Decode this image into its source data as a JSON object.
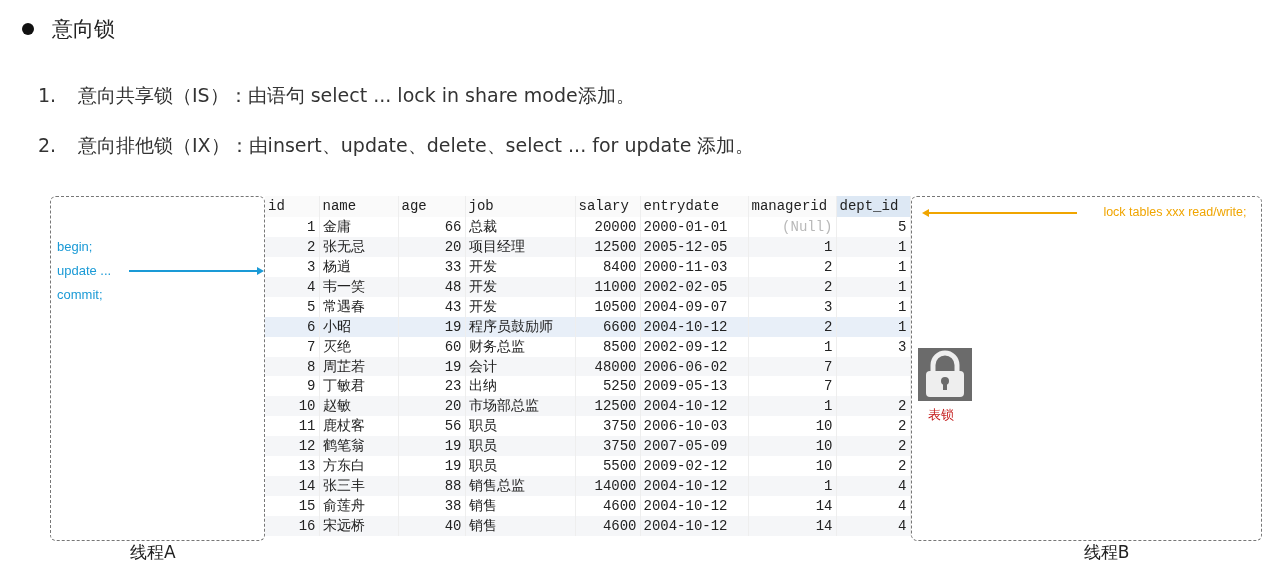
{
  "heading": "意向锁",
  "list": [
    {
      "number": "1.",
      "text": "意向共享锁（IS）：由语句 select ... lock  in share mode添加。"
    },
    {
      "number": "2.",
      "text": "意向排他锁（IX）：由insert、update、delete、select ... for update 添加。"
    }
  ],
  "thread_a": {
    "lines": [
      "begin;",
      "update ...",
      "commit;"
    ],
    "label": "线程A"
  },
  "thread_b": {
    "statement": "lock tables xxx read/write;",
    "label": "线程B"
  },
  "lock": {
    "label": "表锁"
  },
  "table": {
    "columns": [
      {
        "label": "id",
        "numeric": true,
        "selected": false
      },
      {
        "label": "name",
        "numeric": false,
        "selected": false
      },
      {
        "label": "age",
        "numeric": true,
        "selected": false
      },
      {
        "label": "job",
        "numeric": false,
        "selected": false
      },
      {
        "label": "salary",
        "numeric": true,
        "selected": false
      },
      {
        "label": "entrydate",
        "numeric": false,
        "selected": false
      },
      {
        "label": "managerid",
        "numeric": true,
        "selected": false
      },
      {
        "label": "dept_id",
        "numeric": true,
        "selected": true
      }
    ],
    "rows": [
      {
        "selected": false,
        "cells": [
          "1",
          "金庸",
          "66",
          "总裁",
          "20000",
          "2000-01-01",
          {
            "text": "(Null)",
            "null": true
          },
          "5"
        ]
      },
      {
        "selected": false,
        "cells": [
          "2",
          "张无忌",
          "20",
          "项目经理",
          "12500",
          "2005-12-05",
          "1",
          "1"
        ]
      },
      {
        "selected": false,
        "cells": [
          "3",
          "杨逍",
          "33",
          "开发",
          "8400",
          "2000-11-03",
          "2",
          "1"
        ]
      },
      {
        "selected": false,
        "cells": [
          "4",
          "韦一笑",
          "48",
          "开发",
          "11000",
          "2002-02-05",
          "2",
          "1"
        ]
      },
      {
        "selected": false,
        "cells": [
          "5",
          "常遇春",
          "43",
          "开发",
          "10500",
          "2004-09-07",
          "3",
          "1"
        ]
      },
      {
        "selected": true,
        "cells": [
          "6",
          "小昭",
          "19",
          "程序员鼓励师",
          "6600",
          "2004-10-12",
          "2",
          "1"
        ]
      },
      {
        "selected": false,
        "cells": [
          "7",
          "灭绝",
          "60",
          "财务总监",
          "8500",
          "2002-09-12",
          "1",
          "3"
        ]
      },
      {
        "selected": false,
        "cells": [
          "8",
          "周芷若",
          "19",
          "会计",
          "48000",
          "2006-06-02",
          "7"
        ]
      },
      {
        "selected": false,
        "cells": [
          "9",
          "丁敏君",
          "23",
          "出纳",
          "5250",
          "2009-05-13",
          "7"
        ]
      },
      {
        "selected": false,
        "cells": [
          "10",
          "赵敏",
          "20",
          "市场部总监",
          "12500",
          "2004-10-12",
          "1",
          "2"
        ]
      },
      {
        "selected": false,
        "cells": [
          "11",
          "鹿杖客",
          "56",
          "职员",
          "3750",
          "2006-10-03",
          "10",
          "2"
        ]
      },
      {
        "selected": false,
        "cells": [
          "12",
          "鹤笔翁",
          "19",
          "职员",
          "3750",
          "2007-05-09",
          "10",
          "2"
        ]
      },
      {
        "selected": false,
        "cells": [
          "13",
          "方东白",
          "19",
          "职员",
          "5500",
          "2009-02-12",
          "10",
          "2"
        ]
      },
      {
        "selected": false,
        "cells": [
          "14",
          "张三丰",
          "88",
          "销售总监",
          "14000",
          "2004-10-12",
          "1",
          "4"
        ]
      },
      {
        "selected": false,
        "cells": [
          "15",
          "俞莲舟",
          "38",
          "销售",
          "4600",
          "2004-10-12",
          "14",
          "4"
        ]
      },
      {
        "selected": false,
        "cells": [
          "16",
          "宋远桥",
          "40",
          "销售",
          "4600",
          "2004-10-12",
          "14",
          "4"
        ]
      }
    ]
  }
}
